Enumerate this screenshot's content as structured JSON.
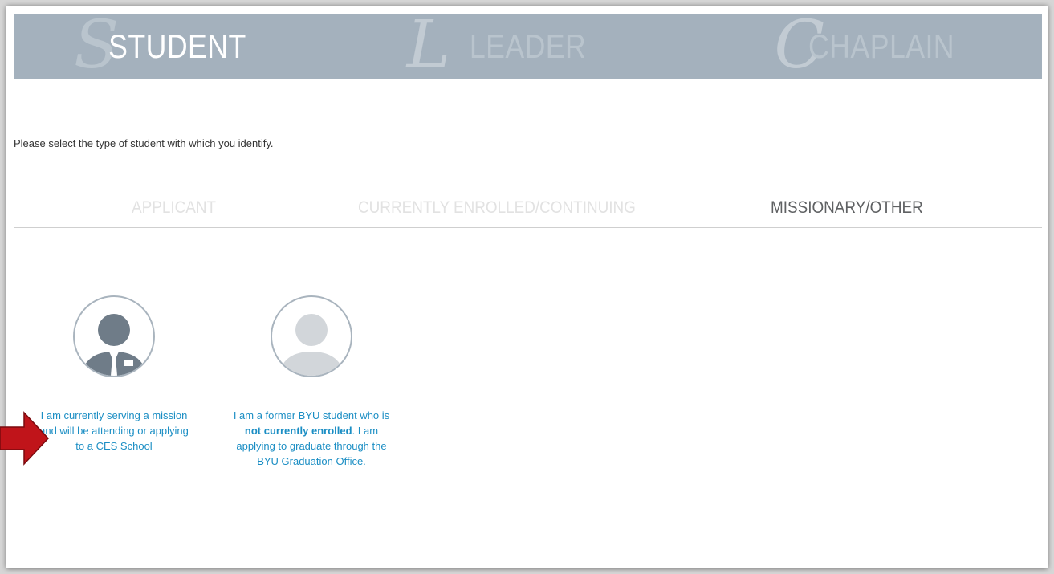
{
  "roles": [
    {
      "initial": "S",
      "label": "STUDENT",
      "active": true
    },
    {
      "initial": "L",
      "label": "LEADER",
      "active": false
    },
    {
      "initial": "C",
      "label": "CHAPLAIN",
      "active": false
    }
  ],
  "prompt": "Please select the type of student with which you identify.",
  "student_types": {
    "applicant": "APPLICANT",
    "enrolled": "CURRENTLY ENROLLED/CONTINUING",
    "missionary": "MISSIONARY/OTHER",
    "active": "MISSIONARY/OTHER"
  },
  "options": {
    "missionary": {
      "icon": "missionary-avatar-icon",
      "text": "I am currently serving a mission and will be attending or applying to a CES School"
    },
    "former": {
      "icon": "person-avatar-icon",
      "text_before": "I am a former BYU student who is ",
      "text_bold": "not currently enrolled",
      "text_after": ". I am applying to graduate through the BYU Graduation Office."
    }
  },
  "annotation": {
    "icon": "red-arrow-icon",
    "color": "#c0141a"
  },
  "colors": {
    "role_bar": "#a4b1bd",
    "link_text": "#1b8ec4",
    "active_tab": "#5f6163",
    "inactive_tab": "#e2e2e2"
  }
}
